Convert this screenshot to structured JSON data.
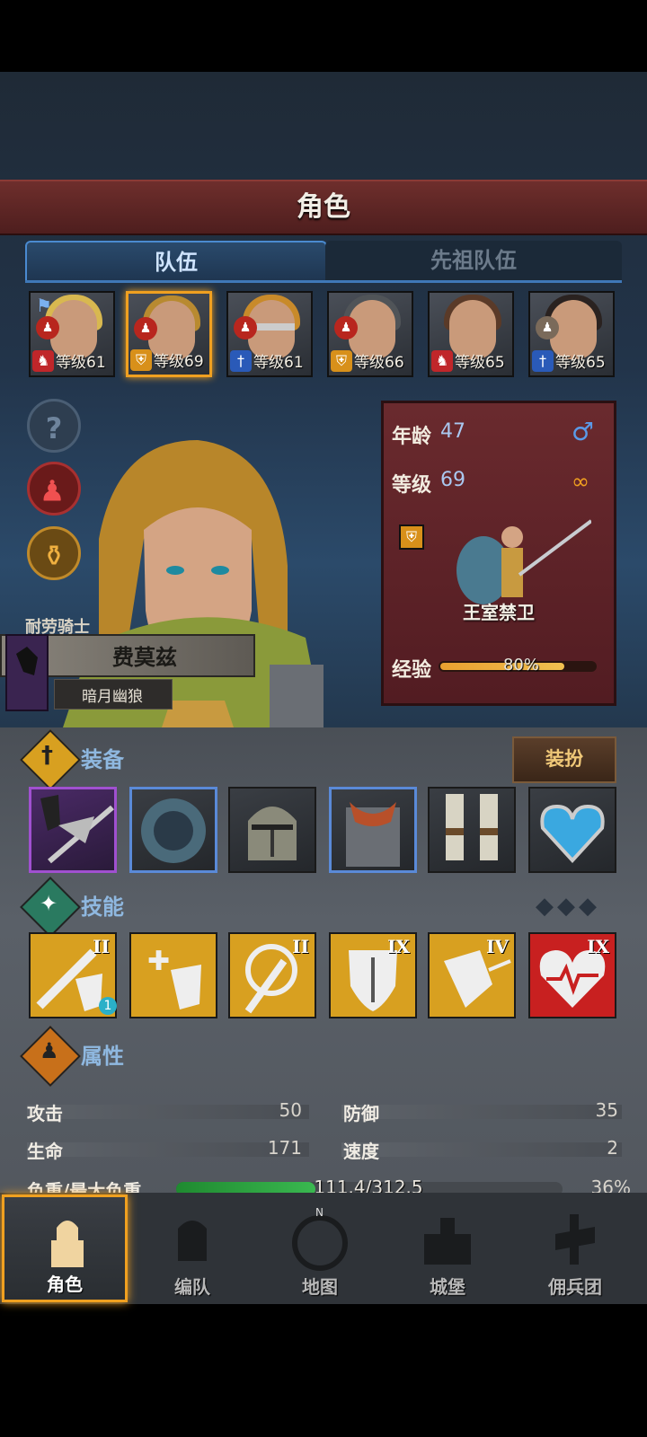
{
  "screen_title": "角色",
  "tabs": [
    {
      "label": "队伍",
      "active": true
    },
    {
      "label": "先祖队伍",
      "active": false
    }
  ],
  "party": [
    {
      "level_label": "等级61",
      "class_icon": "horse-icon",
      "class_color": "#c0262a",
      "hair": "#d8b850",
      "leader": true
    },
    {
      "level_label": "等级69",
      "class_icon": "shield-icon",
      "class_color": "#d8901a",
      "hair": "#b88a30",
      "selected": true
    },
    {
      "level_label": "等级61",
      "class_icon": "sword-icon",
      "class_color": "#2a5ab8",
      "hair": "#c88a2a"
    },
    {
      "level_label": "等级66",
      "class_icon": "shield-icon",
      "class_color": "#d8901a",
      "hair": "#505458"
    },
    {
      "level_label": "等级65",
      "class_icon": "horse-icon",
      "class_color": "#c0262a",
      "hair": "#5a3a28"
    },
    {
      "level_label": "等级65",
      "class_icon": "sword-icon",
      "class_color": "#2a5ab8",
      "hair": "#2a2220"
    }
  ],
  "character": {
    "title": "耐劳骑士",
    "name": "费莫兹",
    "subtitle": "暗月幽狼",
    "age_label": "年龄",
    "age": "47",
    "level_label": "等级",
    "level": "69",
    "gender_icon": "male-icon",
    "marriage_icon": "rings-icon",
    "class_name": "王室禁卫",
    "exp_label": "经验",
    "exp_text": "80%",
    "exp_fraction": 0.8
  },
  "equipment": {
    "title": "装备",
    "dress_button": "装扮",
    "slots": [
      {
        "name": "weapon-lance",
        "border": "#a050d0"
      },
      {
        "name": "shield-feathers",
        "border": "#5a8ad8"
      },
      {
        "name": "helmet",
        "border": "#1a1a1a"
      },
      {
        "name": "armor-chainmail",
        "border": "#5a8ad8"
      },
      {
        "name": "boots",
        "border": "#1a1a1a"
      },
      {
        "name": "amulet-heart",
        "border": "#1a1a1a"
      }
    ]
  },
  "skills": {
    "title": "技能",
    "items": [
      {
        "rank": "II",
        "bg": "#d8a020",
        "badge": "1"
      },
      {
        "rank": "",
        "bg": "#d8a020"
      },
      {
        "rank": "II",
        "bg": "#d8a020"
      },
      {
        "rank": "IX",
        "bg": "#d8a020"
      },
      {
        "rank": "IV",
        "bg": "#d8a020"
      },
      {
        "rank": "IX",
        "bg": "#c82020"
      }
    ]
  },
  "attributes": {
    "title": "属性",
    "attack_label": "攻击",
    "attack": "50",
    "defense_label": "防御",
    "defense": "35",
    "hp_label": "生命",
    "hp": "171",
    "speed_label": "速度",
    "speed": "2",
    "load_label": "负重/最大负重",
    "load_text": "111.4/312.5",
    "load_percent": "36%",
    "load_fraction": 0.36
  },
  "nav": [
    {
      "label": "角色",
      "active": true
    },
    {
      "label": "编队",
      "active": false
    },
    {
      "label": "地图",
      "active": false
    },
    {
      "label": "城堡",
      "active": false
    },
    {
      "label": "佣兵团",
      "active": false
    }
  ],
  "colors": {
    "accent": "#f0a020",
    "tab_blue": "#4a8ad0",
    "title_red": "#6e2e2c",
    "load_green": "#2fa040"
  }
}
